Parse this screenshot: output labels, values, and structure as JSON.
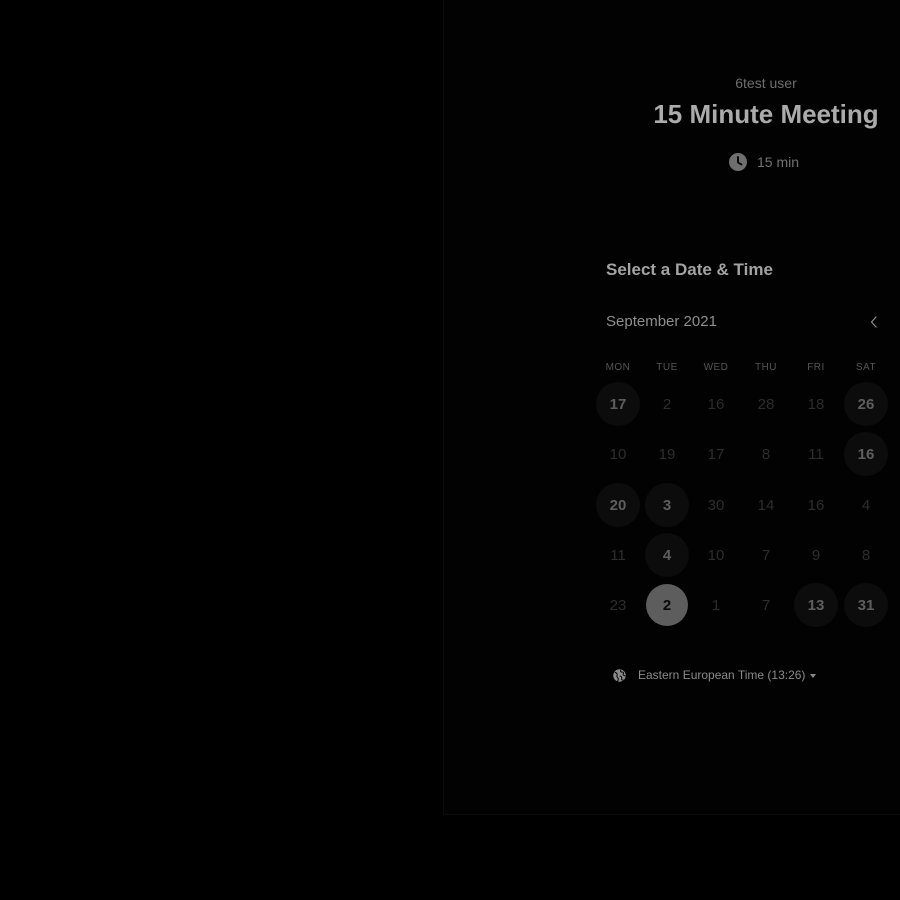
{
  "event": {
    "organizer": "6test user",
    "title": "15 Minute Meeting",
    "duration": "15 min",
    "duration_icon": "clock-icon"
  },
  "scheduler": {
    "heading": "Select a Date & Time",
    "month": "September 2021",
    "prev_icon": "chevron-left-icon",
    "weekdays": [
      "MON",
      "TUE",
      "WED",
      "THU",
      "FRI",
      "SAT"
    ],
    "weeks": [
      [
        {
          "label": "17",
          "available": true
        },
        {
          "label": "2",
          "available": false
        },
        {
          "label": "16",
          "available": false
        },
        {
          "label": "28",
          "available": false
        },
        {
          "label": "18",
          "available": false
        },
        {
          "label": "26",
          "available": true
        }
      ],
      [
        {
          "label": "10",
          "available": false
        },
        {
          "label": "19",
          "available": false
        },
        {
          "label": "17",
          "available": false
        },
        {
          "label": "8",
          "available": false
        },
        {
          "label": "11",
          "available": false
        },
        {
          "label": "16",
          "available": true
        }
      ],
      [
        {
          "label": "20",
          "available": true
        },
        {
          "label": "3",
          "available": true
        },
        {
          "label": "30",
          "available": false
        },
        {
          "label": "14",
          "available": false
        },
        {
          "label": "16",
          "available": false
        },
        {
          "label": "4",
          "available": false
        }
      ],
      [
        {
          "label": "11",
          "available": false
        },
        {
          "label": "4",
          "available": true
        },
        {
          "label": "10",
          "available": false
        },
        {
          "label": "7",
          "available": false
        },
        {
          "label": "9",
          "available": false
        },
        {
          "label": "8",
          "available": false
        }
      ],
      [
        {
          "label": "23",
          "available": false
        },
        {
          "label": "2",
          "available": true,
          "selected": true
        },
        {
          "label": "1",
          "available": false
        },
        {
          "label": "7",
          "available": false
        },
        {
          "label": "13",
          "available": true
        },
        {
          "label": "31",
          "available": true
        }
      ]
    ],
    "timezone": "Eastern European Time (13:26)",
    "timezone_icon": "globe-icon"
  },
  "colors": {
    "background": "#000000",
    "panel": "#020202",
    "title": "#ababab",
    "selected_day": "#5d5d5d",
    "available_day_bg": "#0c0c0c"
  }
}
